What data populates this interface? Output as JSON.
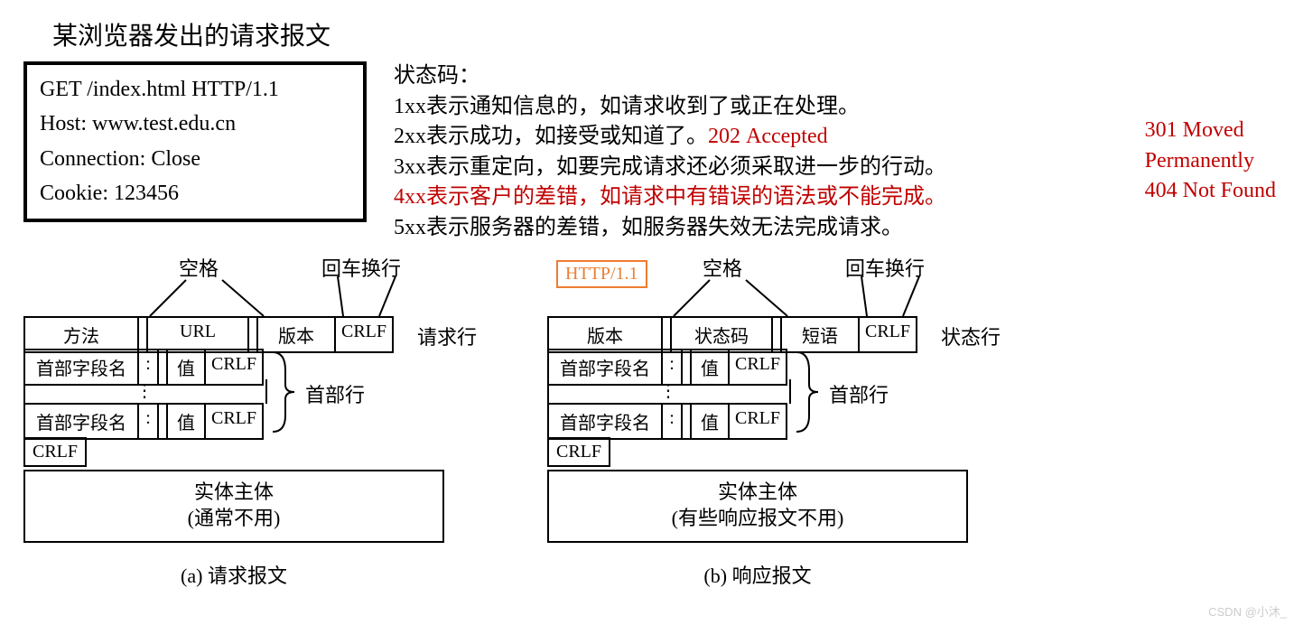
{
  "title": "某浏览器发出的请求报文",
  "request": {
    "l1": "GET /index.html HTTP/1.1",
    "l2": "Host: www.test.edu.cn",
    "l3": "Connection: Close",
    "l4": "Cookie: 123456"
  },
  "codes": {
    "head": "状态码：",
    "l1": "1xx表示通知信息的，如请求收到了或正在处理。",
    "l2a": "2xx表示成功，如接受或知道了。",
    "l2b": "202 Accepted",
    "l3": "3xx表示重定向，如要完成请求还必须采取进一步的行动。",
    "l4a": "4xx表示客户的差错，如请求中有错误的语法或不能完成。",
    "l5": "5xx表示服务器的差错，如服务器失效无法完成请求。"
  },
  "side": {
    "a": "301 Moved",
    "b": "Permanently",
    "c": "404 Not Found"
  },
  "labels": {
    "space": "空格",
    "crlfword": "回车换行",
    "method": "方法",
    "url": "URL",
    "version": "版本",
    "crlf": "CRLF",
    "reqline": "请求行",
    "statusline": "状态行",
    "headers": "首部行",
    "hname": "首部字段名",
    "colon": ":",
    "value": "值",
    "status": "状态码",
    "phrase": "短语",
    "body_a_1": "实体主体",
    "body_a_2": "(通常不用)",
    "body_b_1": "实体主体",
    "body_b_2": "(有些响应报文不用)",
    "cap_a": "(a) 请求报文",
    "cap_b": "(b) 响应报文",
    "http": "HTTP/1.1"
  },
  "watermark": "CSDN @小沐_"
}
